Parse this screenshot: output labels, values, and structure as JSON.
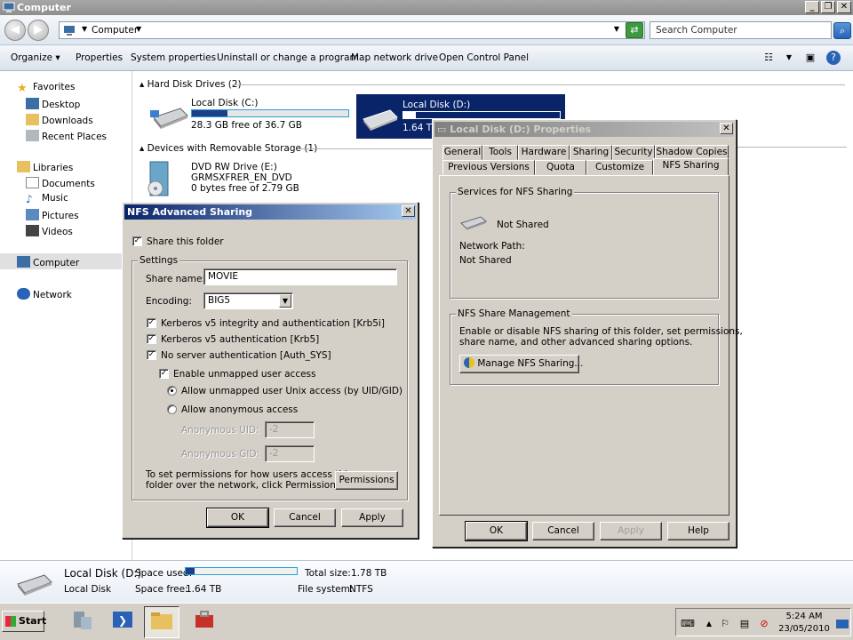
{
  "window": {
    "title": "Computer"
  },
  "address": {
    "crumb": "Computer",
    "search_placeholder": "Search Computer"
  },
  "commands": [
    "Organize",
    "Properties",
    "System properties",
    "Uninstall or change a program",
    "Map network drive",
    "Open Control Panel"
  ],
  "nav": {
    "favorites": "Favorites",
    "desktop": "Desktop",
    "downloads": "Downloads",
    "recent": "Recent Places",
    "libraries": "Libraries",
    "documents": "Documents",
    "music": "Music",
    "pictures": "Pictures",
    "videos": "Videos",
    "computer": "Computer",
    "network": "Network"
  },
  "content": {
    "hdd_group": "Hard Disk Drives (2)",
    "removable_group": "Devices with Removable Storage (1)",
    "drive_c": {
      "name": "Local Disk (C:)",
      "free": "28.3 GB free of 36.7 GB",
      "used_fraction": 0.23
    },
    "drive_d": {
      "name": "Local Disk (D:)",
      "free": "1.64 TB",
      "used_fraction": 0.08
    },
    "drive_e": {
      "name": "DVD RW Drive (E:)",
      "label": "GRMSXFRER_EN_DVD",
      "free": "0 bytes free of 2.79 GB"
    }
  },
  "details": {
    "name": "Local Disk (D:)",
    "type": "Local Disk",
    "space_used_label": "Space used:",
    "space_free_label": "Space free:",
    "space_free": "1.64 TB",
    "total_size_label": "Total size:",
    "total_size": "1.78 TB",
    "filesystem_label": "File system:",
    "filesystem": "NTFS",
    "used_fraction": 0.08
  },
  "properties": {
    "title": "Local Disk (D:) Properties",
    "tabs_row1": [
      "General",
      "Tools",
      "Hardware",
      "Sharing",
      "Security",
      "Shadow Copies"
    ],
    "tabs_row2": [
      "Previous Versions",
      "Quota",
      "Customize",
      "NFS Sharing"
    ],
    "services_group": "Services for NFS Sharing",
    "status": "Not Shared",
    "network_path_label": "Network Path:",
    "network_path": "Not Shared",
    "mgmt_group": "NFS Share Management",
    "mgmt_desc": [
      "Enable or disable NFS sharing of this folder, set permissions,",
      "share name, and other advanced sharing options."
    ],
    "manage_button": "Manage NFS Sharing...",
    "ok": "OK",
    "cancel": "Cancel",
    "apply": "Apply",
    "help": "Help"
  },
  "nfs": {
    "title": "NFS Advanced Sharing",
    "share_folder": "Share this folder",
    "settings_group": "Settings",
    "share_name_label": "Share name:",
    "share_name": "MOVIE",
    "encoding_label": "Encoding:",
    "encoding": "BIG5",
    "krb5i": "Kerberos v5 integrity and authentication [Krb5i]",
    "krb5": "Kerberos v5 authentication [Krb5]",
    "auth_sys": "No server authentication [Auth_SYS]",
    "unmapped": "Enable unmapped user access",
    "allow_unix": "Allow unmapped user Unix access (by UID/GID)",
    "allow_anon": "Allow anonymous access",
    "anon_uid_label": "Anonymous UID:",
    "anon_uid": "-2",
    "anon_gid_label": "Anonymous GID:",
    "anon_gid": "-2",
    "perm_text": [
      "To set permissions for how users access this",
      "folder over the network, click Permissions"
    ],
    "permissions": "Permissions",
    "ok": "OK",
    "cancel": "Cancel",
    "apply": "Apply"
  },
  "taskbar": {
    "start": "Start",
    "time": "5:24 AM",
    "date": "23/05/2010"
  },
  "colors": {
    "selection": "#0a246a",
    "bar_fill": "#1d3f8a",
    "title_active": "#0a246a"
  }
}
